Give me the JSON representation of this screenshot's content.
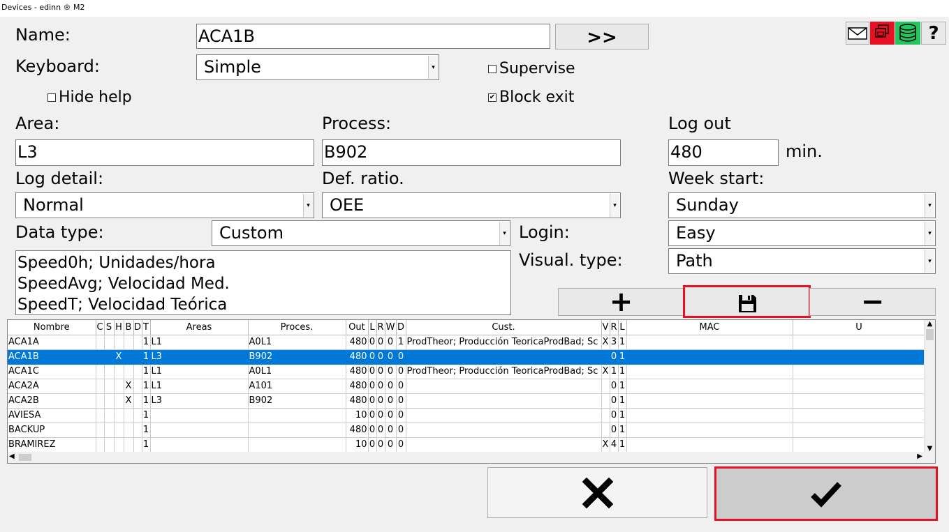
{
  "window": {
    "title": "Devices - edinn ® M2"
  },
  "form": {
    "name_label": "Name:",
    "name_value": "ACA1B",
    "next_label": ">>",
    "keyboard_label": "Keyboard:",
    "keyboard_value": "Simple",
    "supervise_label": "Supervise",
    "supervise_checked": false,
    "hide_help_label": "Hide help",
    "hide_help_checked": false,
    "block_exit_label": "Block exit",
    "block_exit_checked": true,
    "area_label": "Area:",
    "area_value": "L3",
    "process_label": "Process:",
    "process_value": "B902",
    "logout_label": "Log out",
    "logout_value": "480",
    "logout_unit": "min.",
    "log_detail_label": "Log detail:",
    "log_detail_value": "Normal",
    "def_ratio_label": "Def. ratio.",
    "def_ratio_value": "OEE",
    "week_start_label": "Week start:",
    "week_start_value": "Sunday",
    "data_type_label": "Data type:",
    "data_type_value": "Custom",
    "login_label": "Login:",
    "login_value": "Easy",
    "visual_type_label": "Visual. type:",
    "visual_type_value": "Path",
    "data_lines": [
      "Speed0h; Unidades/hora",
      "SpeedAvg; Velocidad Med.",
      "SpeedT; Velocidad Teórica"
    ]
  },
  "toolbar": {
    "add_label": "+",
    "remove_label": "−",
    "icons": [
      "mail-icon",
      "windows-icon",
      "database-icon",
      "help-icon"
    ],
    "help_label": "?"
  },
  "table": {
    "columns": [
      "Nombre",
      "C",
      "S",
      "H",
      "B",
      "D",
      "T",
      "Areas",
      "Proces.",
      "Out",
      "L",
      "R",
      "W",
      "D",
      "Cust.",
      "V",
      "R",
      "L",
      "MAC",
      "U"
    ],
    "rows": [
      [
        "ACA1A",
        "",
        "",
        "",
        "",
        "",
        "1",
        "L1",
        "A0L1",
        "480",
        "0",
        "0",
        "0",
        "1",
        "ProdTheor; Producción TeoricaProdBad; Sc",
        "X",
        "3",
        "1",
        "",
        ""
      ],
      [
        "ACA1B",
        "",
        "",
        "X",
        "",
        "",
        "1",
        "L3",
        "B902",
        "480",
        "0",
        "0",
        "0",
        "0",
        "",
        "",
        "0",
        "1",
        "",
        ""
      ],
      [
        "ACA1C",
        "",
        "",
        "",
        "",
        "",
        "1",
        "L1",
        "A0L1",
        "480",
        "0",
        "0",
        "0",
        "0",
        "ProdTheor; Producción TeoricaProdBad; Sc",
        "X",
        "1",
        "1",
        "",
        ""
      ],
      [
        "ACA2A",
        "",
        "",
        "",
        "X",
        "",
        "1",
        "L1",
        "A101",
        "480",
        "0",
        "0",
        "0",
        "0",
        "",
        "",
        "0",
        "1",
        "",
        ""
      ],
      [
        "ACA2B",
        "",
        "",
        "",
        "X",
        "",
        "1",
        "L3",
        "B902",
        "480",
        "0",
        "0",
        "0",
        "0",
        "",
        "",
        "0",
        "1",
        "",
        ""
      ],
      [
        "AVIESA",
        "",
        "",
        "",
        "",
        "",
        "1",
        "",
        "",
        "10",
        "0",
        "0",
        "0",
        "0",
        "",
        "",
        "0",
        "1",
        "",
        ""
      ],
      [
        "BACKUP",
        "",
        "",
        "",
        "",
        "",
        "1",
        "",
        "",
        "480",
        "0",
        "0",
        "0",
        "0",
        "",
        "",
        "0",
        "1",
        "",
        ""
      ],
      [
        "BRAMIREZ",
        "",
        "",
        "",
        "",
        "",
        "1",
        "",
        "",
        "10",
        "0",
        "0",
        "0",
        "0",
        "",
        "X",
        "4",
        "1",
        "",
        ""
      ]
    ],
    "selected_row": 1
  },
  "footer": {
    "cancel_icon": "close-icon",
    "ok_icon": "checkmark-icon"
  },
  "colors": {
    "selection": "#0078d7",
    "highlight_border": "#e81123",
    "windows_icon_bg": "#e81123",
    "db_icon_bg": "#22c55e"
  }
}
